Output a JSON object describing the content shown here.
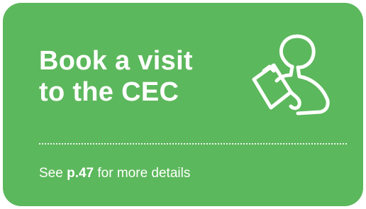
{
  "card": {
    "title_line1": "Book a visit",
    "title_line2": "to the CEC",
    "details_prefix": "See",
    "details_page": "p.47",
    "details_suffix": "for more details",
    "icon": "person-with-clipboard-icon",
    "colors": {
      "background": "#5cb85c",
      "text": "#ffffff"
    }
  }
}
